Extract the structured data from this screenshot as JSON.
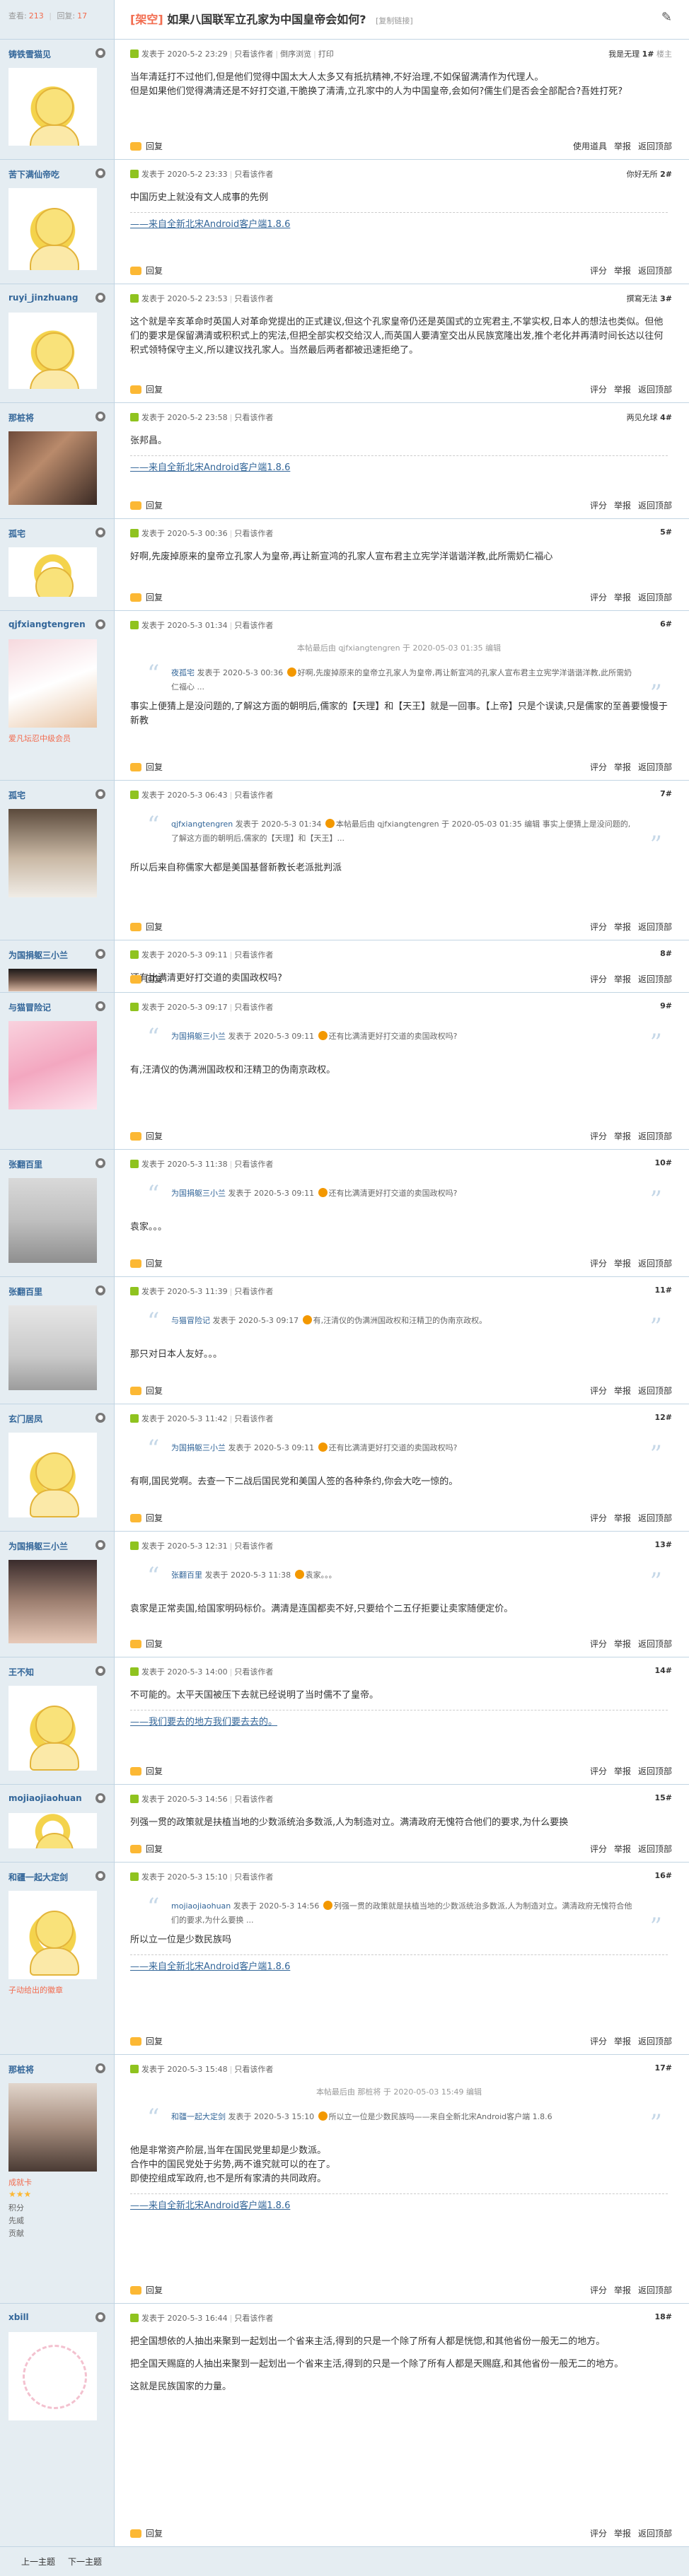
{
  "header": {
    "views_label": "查看:",
    "views": "213",
    "replies_label": "回复:",
    "replies": "17",
    "type_tag": "[架空]",
    "title": "如果八国联军立孔家为中国皇帝会如何?",
    "copy_link": "[复制链接]"
  },
  "common": {
    "author_prefix": "发表于",
    "only_author": "只看该作者",
    "reply": "回复",
    "rate": "评分",
    "report": "举报",
    "top": "返回顶部",
    "sig_text": "——来自全新北宋Android客户端1.8.6"
  },
  "posts": [
    {
      "user": "铸铁雪猫见",
      "time": "2020-5-2 23:29",
      "extra": "倒序浏览",
      "print": "打印",
      "floor_label": "我是无理",
      "floor": "1#",
      "floor_word": "楼主",
      "body": [
        "当年清廷打不过他们,但是他们觉得中国太大人太多又有抵抗精神,不好治理,不如保留满清作为代理人。",
        "但是如果他们觉得满清还是不好打交道,干脆换了清清,立孔家中的人为中国皇帝,会如何?儒生们是否会全部配合?吾姓打死?"
      ],
      "acts": [
        "使用道具",
        "举报",
        "返回顶部"
      ]
    },
    {
      "user": "苦下满仙帝吃",
      "time": "2020-5-2 23:33",
      "floor_label": "你好无所",
      "floor": "2#",
      "floor_word": "",
      "body": [
        "中国历史上就没有文人成事的先例"
      ],
      "sig": true
    },
    {
      "user": "ruyi_jinzhuang",
      "time": "2020-5-2 23:53",
      "floor_label": "撰寫无法",
      "floor": "3#",
      "floor_word": "",
      "body": [
        "这个就是辛亥革命时英国人对革命党提出的正式建议,但这个孔家皇帝仍还是英国式的立宪君主,不掌实权,日本人的想法也类似。但他们的要求是保留满清或积积式上的宪法,但把全部实权交给汉人,而英国人要清室交出从民族宽隆出发,推个老化并再清时间长达以往何积式领特保守主义,所以建议找孔家人。当然最后两者都被迅速拒绝了。"
      ]
    },
    {
      "user": "那桩将",
      "time": "2020-5-2 23:58",
      "floor_label": "两见允球",
      "floor": "4#",
      "floor_word": "",
      "body": [
        "张邦昌。"
      ],
      "sig": true
    },
    {
      "user": "孤宅",
      "time": "2020-5-3 00:36",
      "floor_label": "",
      "floor": "5#",
      "floor_word": "",
      "body": [
        "好啊,先废掉原来的皇帝立孔家人为皇帝,再让新宣鸿的孔家人宣布君主立宪学洋谐谐洋教,此所需奶仁福心"
      ]
    },
    {
      "user": "qjfxiangtengren",
      "time": "2020-5-3 01:34",
      "floor_label": "",
      "floor": "6#",
      "floor_word": "",
      "edited": "本帖最后由 qjfxiangtengren 于 2020-05-03 01:35 编辑",
      "quote_user": "夜孤宅",
      "quote_time": "发表于 2020-5-3 00:36",
      "quote_text": "好啊,先废掉原来的皇帝立孔家人为皇帝,再让新宣鸿的孔家人宣布君主立宪学洋谐谐洋教,此所需奶仁福心 ...",
      "body": [
        "事实上便猜上是没问题的,了解这方面的朝明后,儒家的【天理】和【天王】就是一回事。【上帝】只是个误读,只是儒家的至善要慢慢于新教"
      ],
      "level": "爱凡坛忍中级会员"
    },
    {
      "user": "孤宅",
      "time": "2020-5-3 06:43",
      "floor_label": "",
      "floor": "7#",
      "floor_word": "",
      "quote_user": "qjfxiangtengren",
      "quote_time": "发表于 2020-5-3 01:34",
      "quote_text": "本帖最后由 qjfxiangtengren 于 2020-05-03 01:35 编辑 事实上便猜上是没问题的,了解这方面的朝明后,儒家的【天理】和【天王】...",
      "body": [
        "所以后来自称儒家大都是美国基督新教长老派批判派"
      ]
    },
    {
      "user": "为国捐躯三小兰",
      "time": "2020-5-3 09:11",
      "floor_label": "",
      "floor": "8#",
      "floor_word": "",
      "body": [
        "还有比满清更好打交道的卖国政权吗?"
      ]
    },
    {
      "user": "与猫冒险记",
      "time": "2020-5-3 09:17",
      "floor_label": "",
      "floor": "9#",
      "floor_word": "",
      "quote_user": "为国捐躯三小兰",
      "quote_time": "发表于 2020-5-3 09:11",
      "quote_text": "还有比满清更好打交道的卖国政权吗?",
      "body": [
        "有,汪清仪的伪满洲国政权和汪精卫的伪南京政权。"
      ]
    },
    {
      "user": "张翻百里",
      "time": "2020-5-3 11:38",
      "floor_label": "",
      "floor": "10#",
      "floor_word": "",
      "quote_user": "为国捐躯三小兰",
      "quote_time": "发表于 2020-5-3 09:11",
      "quote_text": "还有比满清更好打交道的卖国政权吗?",
      "body": [
        "袁家。。。"
      ]
    },
    {
      "user": "张翻百里",
      "time": "2020-5-3 11:39",
      "floor_label": "",
      "floor": "11#",
      "floor_word": "",
      "quote_user": "与猫冒险记",
      "quote_time": "发表于 2020-5-3 09:17",
      "quote_text": "有,汪清仪的伪满洲国政权和汪精卫的伪南京政权。",
      "body": [
        "那只对日本人友好。。。"
      ]
    },
    {
      "user": "玄门居凤",
      "time": "2020-5-3 11:42",
      "floor_label": "",
      "floor": "12#",
      "floor_word": "",
      "quote_user": "为国捐躯三小兰",
      "quote_time": "发表于 2020-5-3 09:11",
      "quote_text": "还有比满清更好打交道的卖国政权吗?",
      "body": [
        "有啊,国民党啊。去查一下二战后国民党和美国人签的各种条约,你会大吃一惊的。"
      ]
    },
    {
      "user": "为国捐躯三小兰",
      "time": "2020-5-3 12:31",
      "floor_label": "",
      "floor": "13#",
      "floor_word": "",
      "quote_user": "张翻百里",
      "quote_time": "发表于 2020-5-3 11:38",
      "quote_text": "袁家。。。",
      "body": [
        "袁家是正常卖国,给国家明码标价。满清是连国都卖不好,只要给个二五仔拒要让卖家随便定价。"
      ]
    },
    {
      "user": "王不知",
      "time": "2020-5-3 14:00",
      "floor_label": "",
      "floor": "14#",
      "floor_word": "",
      "body": [
        "不可能的。太平天国被压下去就已经说明了当时儒不了皇帝。"
      ],
      "sig2": "——我们要去的地方我们要去去的。"
    },
    {
      "user": "mojiaojiaohuan",
      "time": "2020-5-3 14:56",
      "floor_label": "",
      "floor": "15#",
      "floor_word": "",
      "body": [
        "列强一贯的政策就是扶植当地的少数派统治多数派,人为制造对立。满清政府无愧符合他们的要求,为什么要换"
      ]
    },
    {
      "user": "和疆一起大定剑",
      "time": "2020-5-3 15:10",
      "floor_label": "",
      "floor": "16#",
      "floor_word": "",
      "quote_user": "mojiaojiaohuan",
      "quote_time": "发表于 2020-5-3 14:56",
      "quote_text": "列强一贯的政策就是扶植当地的少数派统治多数派,人为制造对立。满清政府无愧符合他们的要求,为什么要换 ...",
      "body": [
        "所以立一位是少数民族吗"
      ],
      "sig": true,
      "level": "子动给出的徽章"
    },
    {
      "user": "那桩将",
      "time": "2020-5-3 15:48",
      "floor_label": "",
      "floor": "17#",
      "floor_word": "",
      "edited": "本帖最后由 那桩将 于 2020-05-03 15:49 编辑",
      "quote_user": "和疆一起大定剑",
      "quote_time": "发表于 2020-5-3 15:10",
      "quote_text": "所以立一位是少数民族吗——来自全新北宋Android客户端 1.8.6",
      "body": [
        "他是非常资产阶层,当年在国民党里却是少数派。",
        "合作中的国民党处于劣势,两不谁究就可以的在了。",
        "即使控组成军政府,也不是所有家清的共同政府。"
      ],
      "sig": true,
      "level": "成就卡",
      "stats": [
        "积分",
        "先威",
        "贡献"
      ]
    },
    {
      "user": "xbill",
      "time": "2020-5-3 16:44",
      "floor_label": "",
      "floor": "18#",
      "floor_word": "",
      "body": [
        "把全国想依的人抽出来聚到一起划出一个省来主活,得到的只是一个除了所有人都是恍惚,和其他省份一般无二的地方。",
        "",
        "把全国天赐庭的人抽出来聚到一起划出一个省来主活,得到的只是一个除了所有人都是天赐庭,和其他省份一般无二的地方。",
        "",
        "这就是民族国家的力量。"
      ]
    }
  ],
  "bottom": {
    "prev": "上一主题",
    "next": "下一主题"
  }
}
